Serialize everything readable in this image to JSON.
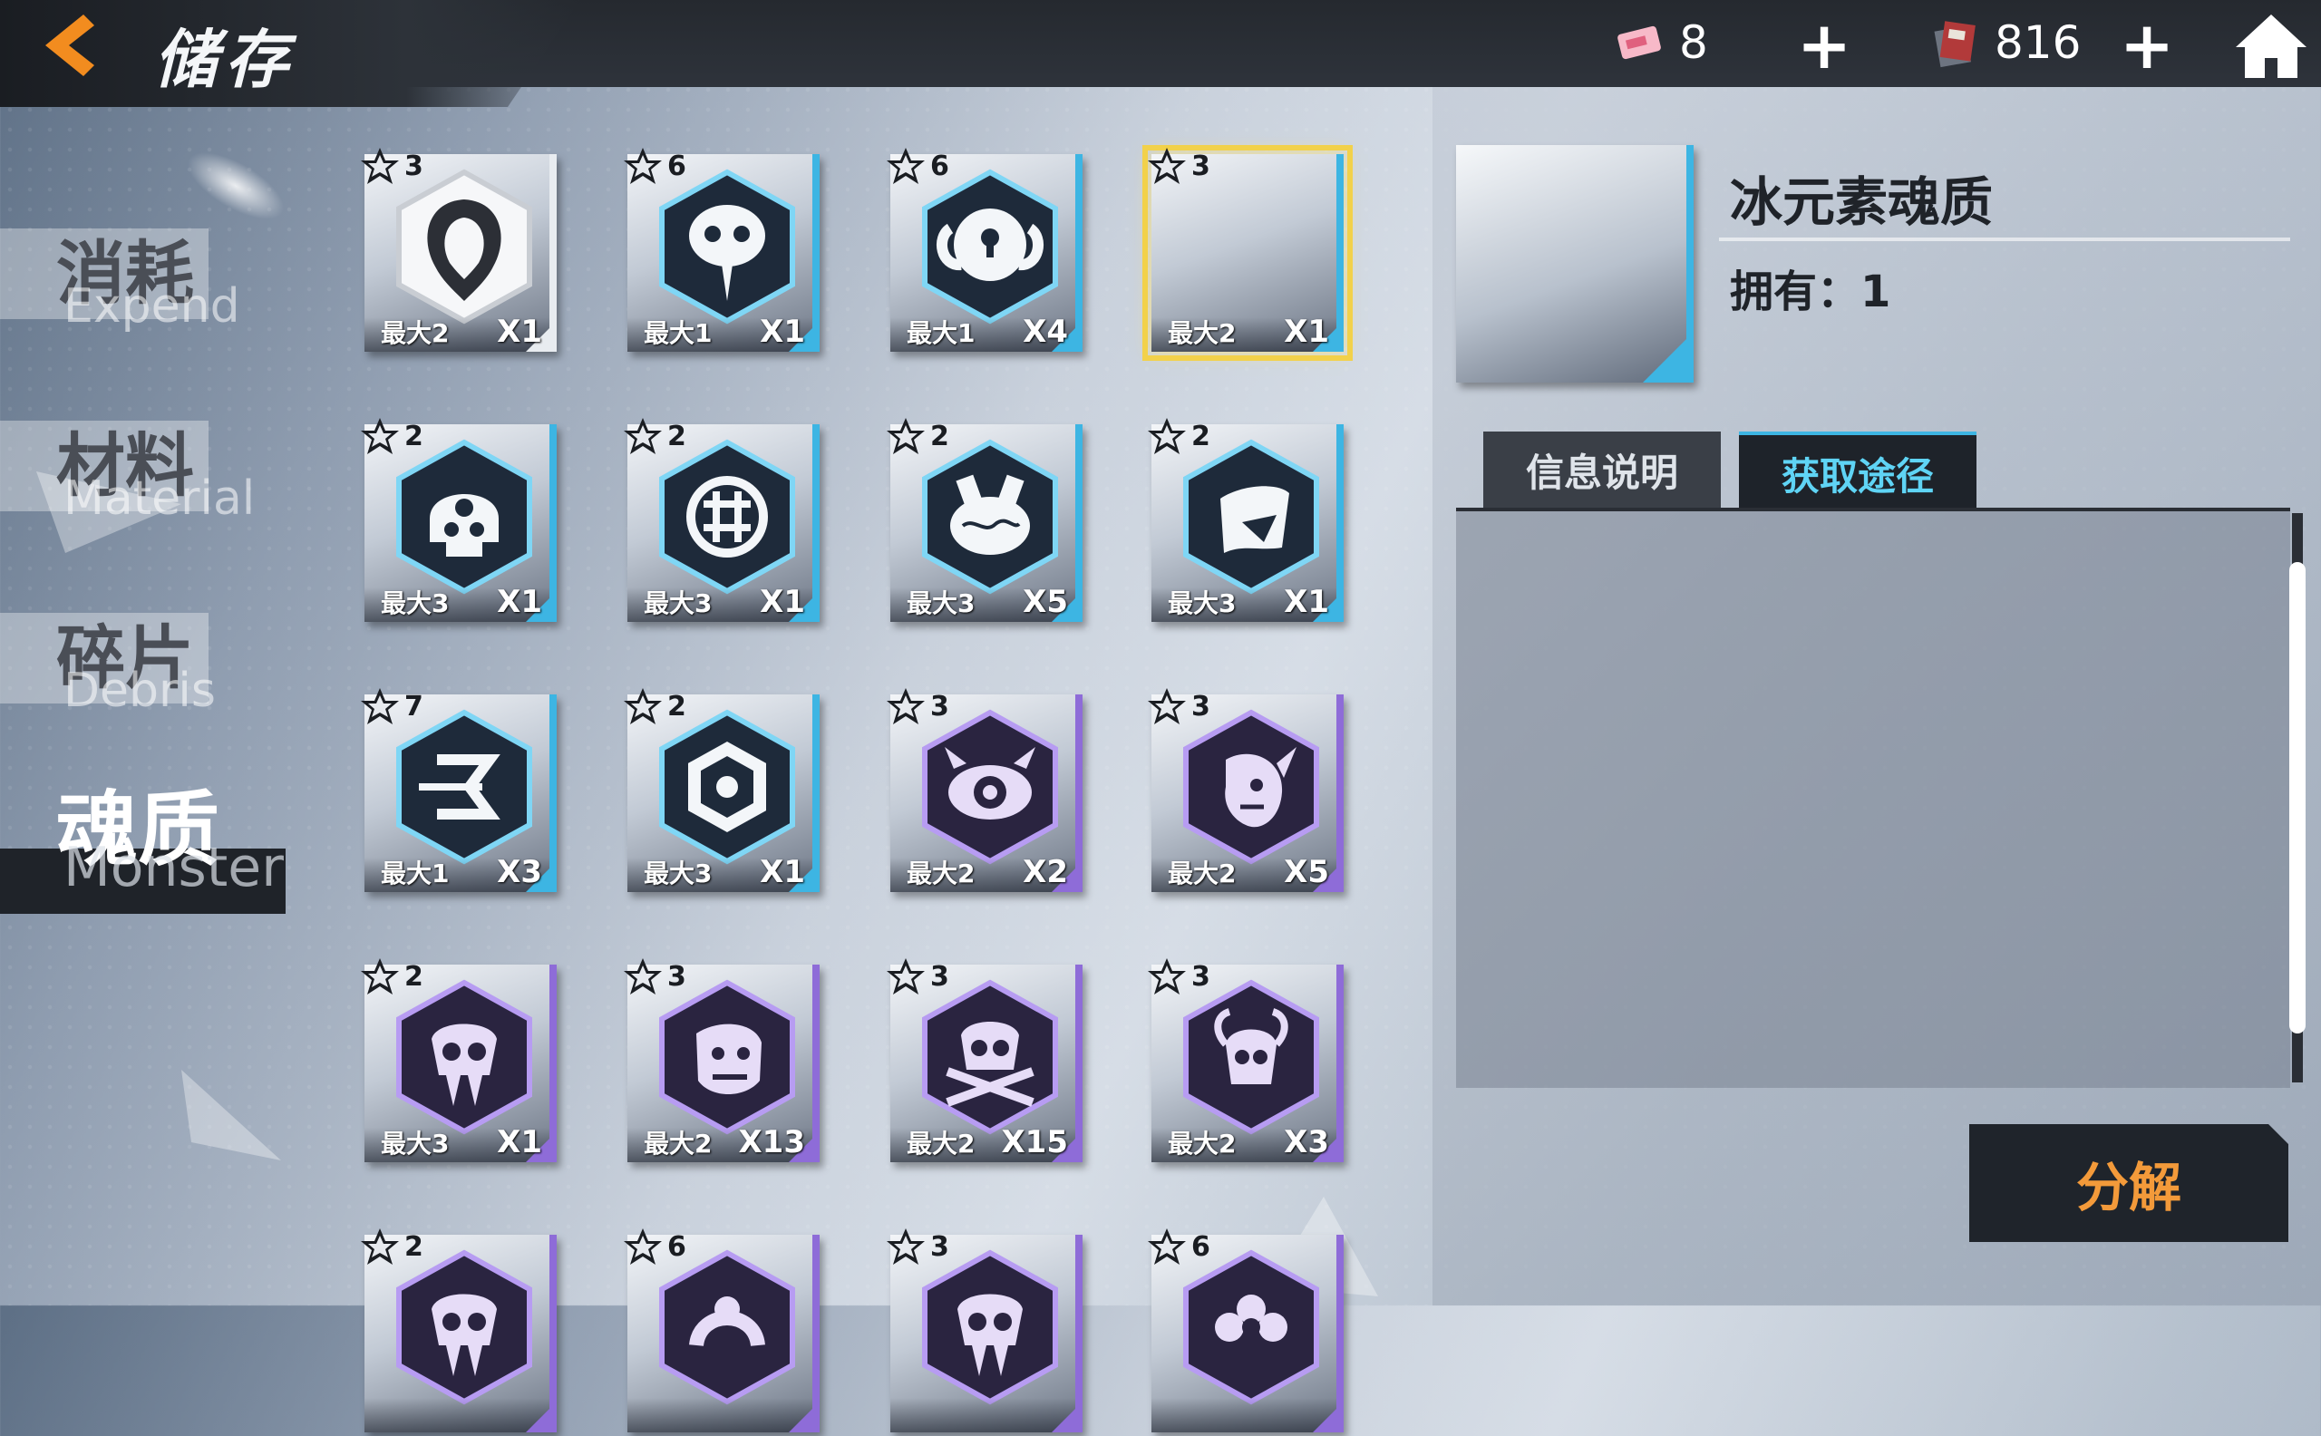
{
  "header": {
    "title": "储存",
    "currency_1": {
      "icon": "ticket-icon",
      "value": "8"
    },
    "currency_2": {
      "icon": "card-pack-icon",
      "value": "816"
    }
  },
  "nav": [
    {
      "cn": "消耗",
      "en": "Expend",
      "active": false
    },
    {
      "cn": "材料",
      "en": "Material",
      "active": false
    },
    {
      "cn": "碎片",
      "en": "Debris",
      "active": false
    },
    {
      "cn": "魂质",
      "en": "Monster",
      "active": true
    }
  ],
  "items": [
    {
      "rank": "3",
      "max": "最大2",
      "qty": "X1",
      "icon": "crescent-hex-icon",
      "accent": "#e8ecf0",
      "selected": false
    },
    {
      "rank": "6",
      "max": "最大1",
      "qty": "X1",
      "icon": "bird-skull-icon",
      "accent": "#3db5e3",
      "selected": false
    },
    {
      "rank": "6",
      "max": "最大1",
      "qty": "X4",
      "icon": "ram-lock-icon",
      "accent": "#3db5e3",
      "selected": false
    },
    {
      "rank": "3",
      "max": "最大2",
      "qty": "X1",
      "icon": "empty-icon",
      "accent": "#3db5e3",
      "selected": true
    },
    {
      "rank": "2",
      "max": "最大3",
      "qty": "X1",
      "icon": "skull-helmet-icon",
      "accent": "#3db5e3",
      "selected": false
    },
    {
      "rank": "2",
      "max": "最大3",
      "qty": "X1",
      "icon": "grid-orb-icon",
      "accent": "#3db5e3",
      "selected": false
    },
    {
      "rank": "2",
      "max": "最大3",
      "qty": "X5",
      "icon": "brain-icon",
      "accent": "#3db5e3",
      "selected": false
    },
    {
      "rank": "2",
      "max": "最大3",
      "qty": "X1",
      "icon": "cloak-icon",
      "accent": "#3db5e3",
      "selected": false
    },
    {
      "rank": "7",
      "max": "最大1",
      "qty": "X3",
      "icon": "arrow-hex-icon",
      "accent": "#3db5e3",
      "selected": false
    },
    {
      "rank": "2",
      "max": "最大3",
      "qty": "X1",
      "icon": "hex-nut-icon",
      "accent": "#3db5e3",
      "selected": false
    },
    {
      "rank": "3",
      "max": "最大2",
      "qty": "X2",
      "icon": "eye-demon-icon",
      "accent": "#8e6cd8",
      "selected": false
    },
    {
      "rank": "3",
      "max": "最大2",
      "qty": "X5",
      "icon": "imp-face-icon",
      "accent": "#8e6cd8",
      "selected": false
    },
    {
      "rank": "2",
      "max": "最大3",
      "qty": "X1",
      "icon": "beast-skull-icon",
      "accent": "#8e6cd8",
      "selected": false
    },
    {
      "rank": "3",
      "max": "最大2",
      "qty": "X13",
      "icon": "ogre-head-icon",
      "accent": "#8e6cd8",
      "selected": false
    },
    {
      "rank": "3",
      "max": "最大2",
      "qty": "X15",
      "icon": "crossed-bones-skull-icon",
      "accent": "#8e6cd8",
      "selected": false
    },
    {
      "rank": "3",
      "max": "最大2",
      "qty": "X3",
      "icon": "horned-skull-icon",
      "accent": "#8e6cd8",
      "selected": false
    },
    {
      "rank": "2",
      "max": "",
      "qty": "",
      "icon": "beast-skull-icon",
      "accent": "#8e6cd8",
      "selected": false
    },
    {
      "rank": "6",
      "max": "",
      "qty": "",
      "icon": "serpent-icon",
      "accent": "#8e6cd8",
      "selected": false
    },
    {
      "rank": "3",
      "max": "",
      "qty": "",
      "icon": "beast-skull-icon",
      "accent": "#8e6cd8",
      "selected": false
    },
    {
      "rank": "6",
      "max": "",
      "qty": "",
      "icon": "flower-icon",
      "accent": "#8e6cd8",
      "selected": false
    }
  ],
  "detail": {
    "name": "冰元素魂质",
    "own": "拥有：1",
    "tabs": {
      "info": "信息说明",
      "source": "获取途径"
    },
    "action": "分解"
  }
}
